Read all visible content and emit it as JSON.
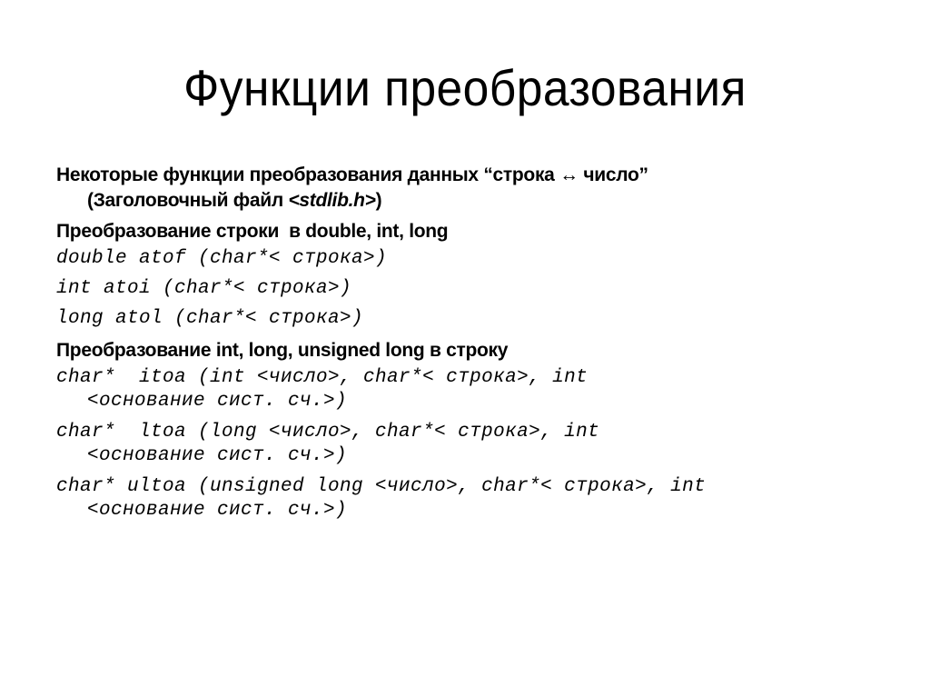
{
  "slide": {
    "title": "Функции преобразования",
    "lines": {
      "intro": "Некоторые функции преобразования данных “строка ↔ число”",
      "header_prefix": "(Заголовочный файл ",
      "header_file": "<stdlib.h>",
      "header_suffix": ")",
      "section1": "Преобразование строки  в double, int, long",
      "atof": "double atof (char*< строка>)",
      "atoi": "int atoi (char*< строка>)",
      "atol": "long atol (char*< строка>)",
      "section2": "Преобразование int, long, unsigned long в строку",
      "itoa_1": "char*  itoa (int <число>, char*< строка>, int",
      "itoa_2": "<основание сист. сч.>)",
      "ltoa_1": "char*  ltoa (long <число>, char*< строка>, int",
      "ltoa_2": "<основание сист. сч.>)",
      "ultoa_1": "char* ultoa (unsigned long <число>, char*< строка>, int",
      "ultoa_2": "<основание сист. сч.>)"
    }
  }
}
